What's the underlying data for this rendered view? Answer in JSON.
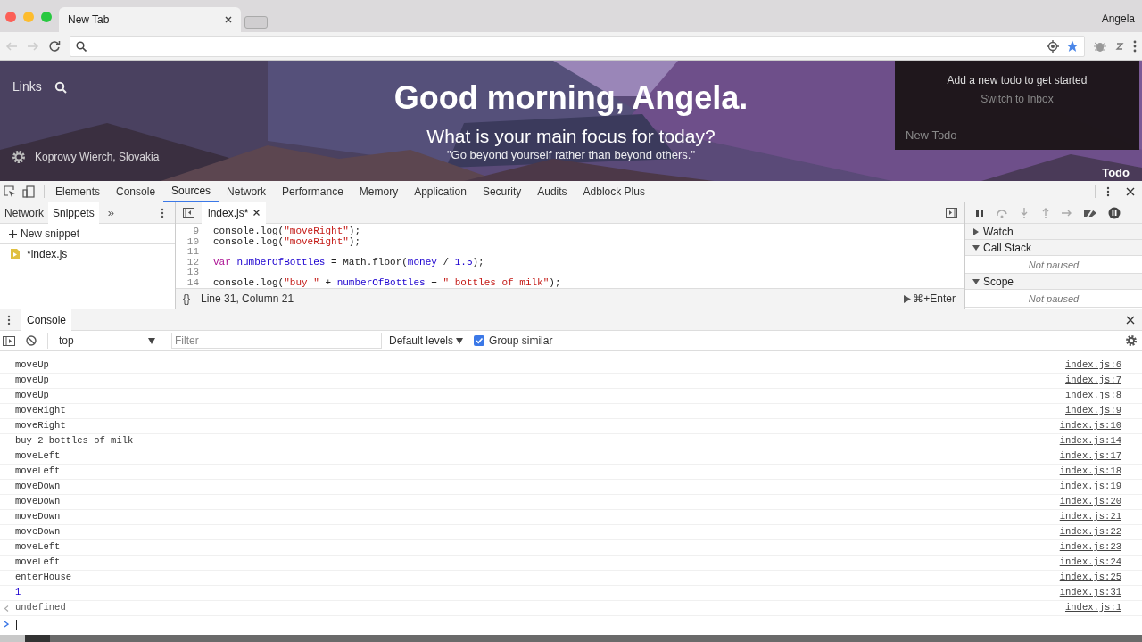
{
  "browser": {
    "tab_title": "New Tab",
    "profile": "Angela"
  },
  "hero": {
    "links": "Links",
    "location": "Koprowy Wierch, Slovakia",
    "greeting": "Good morning, Angela.",
    "focus_question": "What is your main focus for today?",
    "quote": "\"Go beyond yourself rather than beyond others.\""
  },
  "todo": {
    "message": "Add a new todo to get started",
    "switch_link": "Switch to Inbox",
    "placeholder": "New Todo",
    "button": "Todo"
  },
  "devtools": {
    "tabs": [
      {
        "label": "Elements",
        "selected": false
      },
      {
        "label": "Console",
        "selected": false
      },
      {
        "label": "Sources",
        "selected": true
      },
      {
        "label": "Network",
        "selected": false
      },
      {
        "label": "Performance",
        "selected": false
      },
      {
        "label": "Memory",
        "selected": false
      },
      {
        "label": "Application",
        "selected": false
      },
      {
        "label": "Security",
        "selected": false
      },
      {
        "label": "Audits",
        "selected": false
      },
      {
        "label": "Adblock Plus",
        "selected": false
      }
    ]
  },
  "navigator": {
    "tabs": [
      {
        "label": "Network",
        "selected": false
      },
      {
        "label": "Snippets",
        "selected": true
      }
    ],
    "more": "»",
    "new_snippet": "New snippet",
    "files": [
      "*index.js"
    ]
  },
  "editor": {
    "tab": "index.js*",
    "lines": [
      {
        "number": "9",
        "segments": [
          {
            "kind": "plain",
            "text": "console.log("
          },
          {
            "kind": "string",
            "text": "\"moveRight\""
          },
          {
            "kind": "plain",
            "text": ");"
          }
        ]
      },
      {
        "number": "10",
        "segments": [
          {
            "kind": "plain",
            "text": "console.log("
          },
          {
            "kind": "string",
            "text": "\"moveRight\""
          },
          {
            "kind": "plain",
            "text": ");"
          }
        ]
      },
      {
        "number": "11"
      },
      {
        "number": "12",
        "segments": [
          {
            "kind": "keyword",
            "text": "var"
          },
          {
            "kind": "variable",
            "text": " numberOfBottles"
          },
          {
            "kind": "plain",
            "text": " = Math.floor("
          },
          {
            "kind": "variable",
            "text": "money"
          },
          {
            "kind": "plain",
            "text": " / "
          },
          {
            "kind": "number",
            "text": "1.5"
          },
          {
            "kind": "plain",
            "text": ");"
          }
        ]
      },
      {
        "number": "13"
      },
      {
        "number": "14",
        "segments": [
          {
            "kind": "plain",
            "text": "console.log("
          },
          {
            "kind": "string",
            "text": "\"buy \""
          },
          {
            "kind": "plain",
            "text": " + "
          },
          {
            "kind": "variable",
            "text": "numberOfBottles"
          },
          {
            "kind": "plain",
            "text": " + "
          },
          {
            "kind": "string",
            "text": "\" bottles of milk\""
          },
          {
            "kind": "plain",
            "text": ");"
          }
        ]
      }
    ],
    "format": "{}",
    "position": "Line 31, Column 21",
    "run": "⌘+Enter"
  },
  "debugger": {
    "sections": [
      {
        "title": "Watch",
        "expanded": false
      },
      {
        "title": "Call Stack",
        "expanded": true,
        "content": "Not paused"
      },
      {
        "title": "Scope",
        "expanded": true,
        "content": "Not paused"
      }
    ]
  },
  "console": {
    "drawer_tab": "Console",
    "context": "top",
    "filter_placeholder": "Filter",
    "levels": "Default levels",
    "group_similar": {
      "label": "Group similar",
      "checked": true
    },
    "rows": [
      {
        "kind": "log",
        "text": "moveUp",
        "source": "index.js:6"
      },
      {
        "kind": "log",
        "text": "moveUp",
        "source": "index.js:7"
      },
      {
        "kind": "log",
        "text": "moveUp",
        "source": "index.js:8"
      },
      {
        "kind": "log",
        "text": "moveRight",
        "source": "index.js:9"
      },
      {
        "kind": "log",
        "text": "moveRight",
        "source": "index.js:10"
      },
      {
        "kind": "log",
        "text": "buy 2 bottles of milk",
        "source": "index.js:14"
      },
      {
        "kind": "log",
        "text": "moveLeft",
        "source": "index.js:17"
      },
      {
        "kind": "log",
        "text": "moveLeft",
        "source": "index.js:18"
      },
      {
        "kind": "log",
        "text": "moveDown",
        "source": "index.js:19"
      },
      {
        "kind": "log",
        "text": "moveDown",
        "source": "index.js:20"
      },
      {
        "kind": "log",
        "text": "moveDown",
        "source": "index.js:21"
      },
      {
        "kind": "log",
        "text": "moveDown",
        "source": "index.js:22"
      },
      {
        "kind": "log",
        "text": "moveLeft",
        "source": "index.js:23"
      },
      {
        "kind": "log",
        "text": "moveLeft",
        "source": "index.js:24"
      },
      {
        "kind": "log",
        "text": "enterHouse",
        "source": "index.js:25"
      },
      {
        "kind": "number",
        "text": "1",
        "source": "index.js:31"
      },
      {
        "kind": "result",
        "text": "undefined",
        "source": "index.js:1"
      }
    ]
  }
}
